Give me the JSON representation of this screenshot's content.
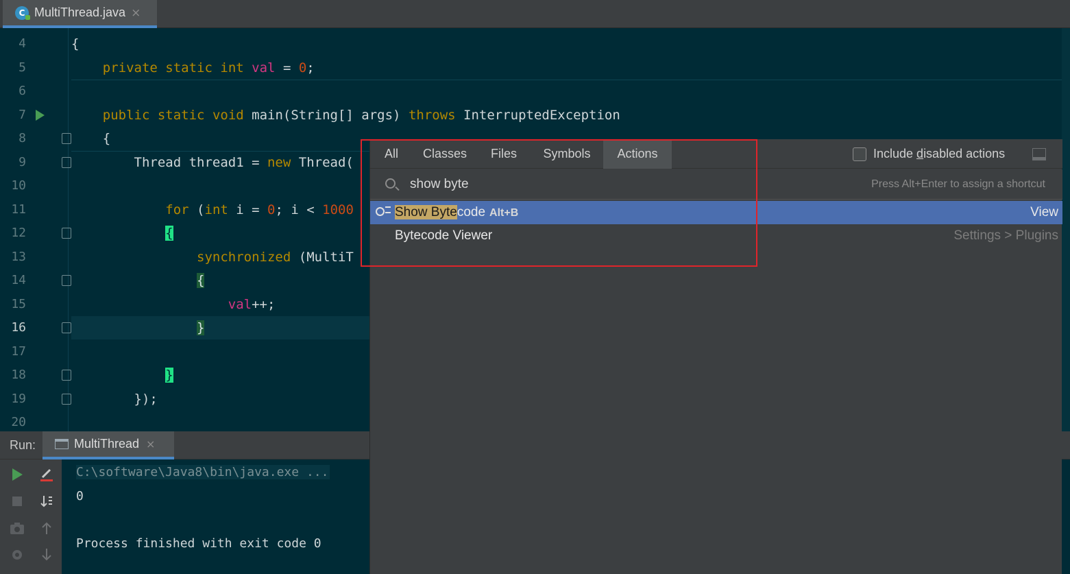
{
  "editor_tab": {
    "filename": "MultiThread.java",
    "icon": "java-class-icon",
    "close": "×"
  },
  "editor": {
    "lines": [
      {
        "n": "4",
        "text": "{"
      },
      {
        "n": "5",
        "text": "    private static int val = 0;"
      },
      {
        "n": "6",
        "text": ""
      },
      {
        "n": "7",
        "text": "    public static void main(String[] args) throws InterruptedException"
      },
      {
        "n": "8",
        "text": "    {"
      },
      {
        "n": "9",
        "text": "        Thread thread1 = new Thread("
      },
      {
        "n": "10",
        "text": ""
      },
      {
        "n": "11",
        "text": "            for (int i = 0; i < 1000"
      },
      {
        "n": "12",
        "text": "            {"
      },
      {
        "n": "13",
        "text": "                synchronized (MultiT"
      },
      {
        "n": "14",
        "text": "                {"
      },
      {
        "n": "15",
        "text": "                    val++;"
      },
      {
        "n": "16",
        "text": "                }"
      },
      {
        "n": "17",
        "text": ""
      },
      {
        "n": "18",
        "text": "            }"
      },
      {
        "n": "19",
        "text": "        });"
      },
      {
        "n": "20",
        "text": ""
      }
    ],
    "current_line": "16"
  },
  "run_panel": {
    "title": "Run:",
    "tab_label": "MultiThread",
    "tab_close": "×",
    "console": [
      "C:\\software\\Java8\\bin\\java.exe ...",
      "0",
      "",
      "Process finished with exit code 0"
    ]
  },
  "popup": {
    "tabs": [
      "All",
      "Classes",
      "Files",
      "Symbols",
      "Actions"
    ],
    "selected_tab": "Actions",
    "include_disabled_label_pre": "Include ",
    "include_disabled_label_u": "d",
    "include_disabled_label_post": "isabled actions",
    "search_value": "show byte",
    "search_hint": "Press Alt+Enter to assign a shortcut",
    "results": [
      {
        "match": "Show Byte",
        "rest": "code",
        "shortcut": "Alt+B",
        "location": "View",
        "icon": "show-bytecode-icon"
      },
      {
        "match": "",
        "rest": "Bytecode Viewer",
        "shortcut": "",
        "location": "Settings > Plugins",
        "icon": ""
      }
    ]
  },
  "colors": {
    "editor_bg": "#002b36",
    "keyword": "#b58900",
    "field": "#d33682",
    "number": "#cb4b16",
    "selection": "#4b6eaf",
    "annotation_box": "#e0242a"
  }
}
